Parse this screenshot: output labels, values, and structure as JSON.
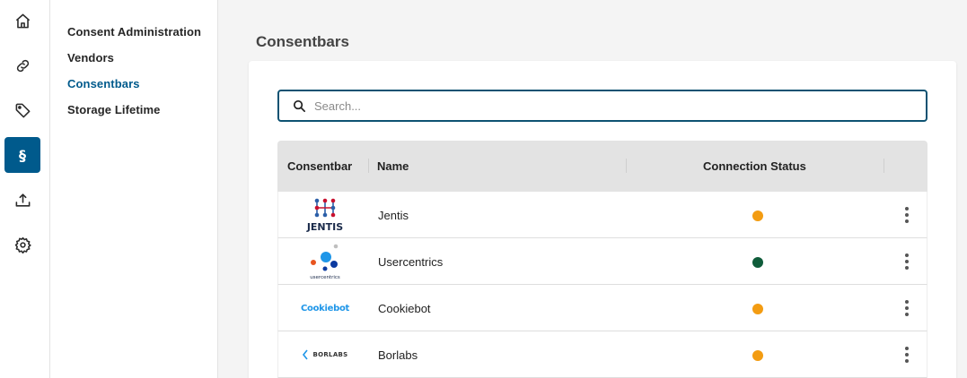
{
  "rail": {
    "items": [
      {
        "icon": "home-icon"
      },
      {
        "icon": "link-icon"
      },
      {
        "icon": "tag-icon"
      },
      {
        "icon": "paragraph-icon",
        "glyph": "§",
        "active": true
      },
      {
        "icon": "upload-icon"
      },
      {
        "icon": "gear-icon"
      }
    ]
  },
  "subnav": {
    "items": [
      {
        "label": "Consent Administration"
      },
      {
        "label": "Vendors"
      },
      {
        "label": "Consentbars",
        "active": true
      },
      {
        "label": "Storage Lifetime"
      }
    ]
  },
  "page": {
    "title": "Consentbars"
  },
  "search": {
    "placeholder": "Search..."
  },
  "table": {
    "columns": [
      "Consentbar",
      "Name",
      "Connection Status"
    ],
    "rows": [
      {
        "logo": "JENTIS",
        "name": "Jentis",
        "status_color": "#f39c12"
      },
      {
        "logo": "usercentrics",
        "name": "Usercentrics",
        "status_color": "#0f5c3a"
      },
      {
        "logo": "Cookiebot",
        "name": "Cookiebot",
        "status_color": "#f39c12"
      },
      {
        "logo": "BORLABS",
        "name": "Borlabs",
        "status_color": "#f39c12"
      }
    ]
  },
  "colors": {
    "accent": "#005a8c",
    "search_border": "#0d5272",
    "status_warning": "#f39c12",
    "status_ok": "#0f5c3a"
  }
}
